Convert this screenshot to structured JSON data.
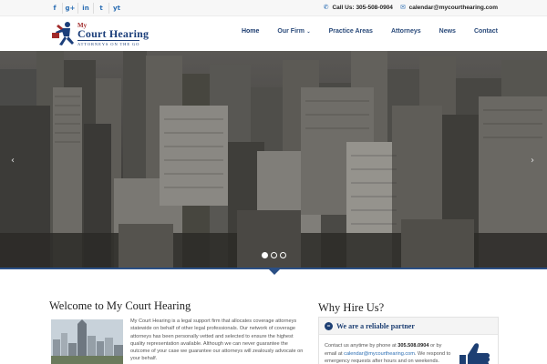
{
  "topbar": {
    "social": [
      "f",
      "g+",
      "in",
      "t",
      "yt"
    ],
    "social_icons": [
      "facebook-icon",
      "google-plus-icon",
      "linkedin-icon",
      "twitter-icon",
      "youtube-icon"
    ],
    "phone_label": "Call Us: 305-508-0904",
    "email_label": "calendar@mycourthearing.com"
  },
  "brand": {
    "my": "My",
    "name": "Court Hearing",
    "tagline": "ATTORNEYS ON THE GO"
  },
  "nav": {
    "items": [
      "Home",
      "Our Firm",
      "Practice Areas",
      "Attorneys",
      "News",
      "Contact"
    ]
  },
  "welcome": {
    "title": "Welcome to My Court Hearing",
    "text": "My Court Hearing is a legal support firm that allocates coverage attorneys statewide on behalf of other legal professionals. Our network of coverage attorneys has been personally vetted and selected to ensure the highest quality representation available. Although we can never guarantee the outcome of your case we guarantee our attorneys will zealously advocate on your behalf."
  },
  "hire": {
    "title": "Why Hire Us?",
    "panel_title": "We are a reliable partner",
    "text_1": "Contact us anytime by phone at ",
    "phone": "305.508.0904",
    "text_2": " or by email at ",
    "email": "calendar@mycourthearing.com",
    "text_3": ". We respond to emergency requests after hours and on weekends."
  },
  "colors": {
    "accent": "#2a4f85",
    "brand_blue": "#1b3e7a",
    "brand_red": "#a12a2a"
  }
}
